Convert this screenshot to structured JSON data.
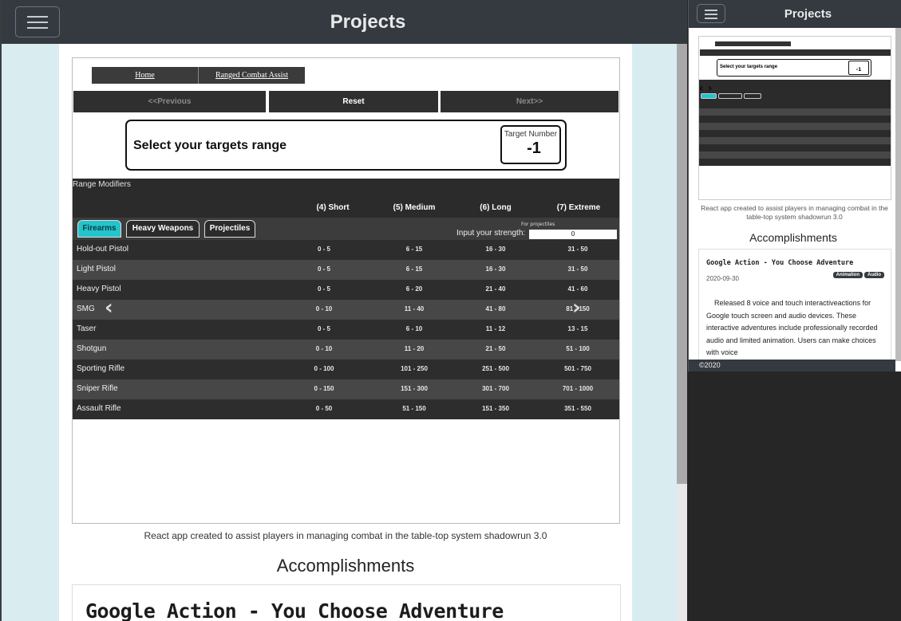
{
  "main": {
    "nav_title": "Projects",
    "project": {
      "breadcrumb": {
        "home": "Home",
        "current": "Ranged Combat Assist"
      },
      "nav": {
        "previous": "<<Previous",
        "reset": "Reset",
        "next": "Next>>"
      },
      "select_heading": "Select your targets range",
      "target_number": {
        "label": "Target Number",
        "value": "-1"
      },
      "table": {
        "caption": "Range Modifiers",
        "columns": [
          "(4) Short",
          "(5) Medium",
          "(6) Long",
          "(7) Extreme"
        ],
        "tabs": [
          "Firearms",
          "Heavy Weapons",
          "Projectiles"
        ],
        "active_tab": "Firearms",
        "for_projectiles": "For projectiles",
        "strength_label": "Input your strength:",
        "strength_value": "0",
        "rows": [
          {
            "name": "Hold-out Pistol",
            "short": "0 - 5",
            "medium": "6 - 15",
            "long": "16 - 30",
            "extreme": "31 - 50"
          },
          {
            "name": "Light Pistol",
            "short": "0 - 5",
            "medium": "6 - 15",
            "long": "16 - 30",
            "extreme": "31 - 50"
          },
          {
            "name": "Heavy Pistol",
            "short": "0 - 5",
            "medium": "6 - 20",
            "long": "21 - 40",
            "extreme": "41 - 60"
          },
          {
            "name": "SMG",
            "short": "0 - 10",
            "medium": "11 - 40",
            "long": "41 - 80",
            "extreme": "81 - 150"
          },
          {
            "name": "Taser",
            "short": "0 - 5",
            "medium": "6 - 10",
            "long": "11 - 12",
            "extreme": "13 - 15"
          },
          {
            "name": "Shotgun",
            "short": "0 - 10",
            "medium": "11 - 20",
            "long": "21 - 50",
            "extreme": "51 - 100"
          },
          {
            "name": "Sporting Rifle",
            "short": "0 - 100",
            "medium": "101 - 250",
            "long": "251 - 500",
            "extreme": "501 - 750"
          },
          {
            "name": "Sniper Rifle",
            "short": "0 - 150",
            "medium": "151 - 300",
            "long": "301 - 700",
            "extreme": "701 - 1000"
          },
          {
            "name": "Assault Rifle",
            "short": "0 - 50",
            "medium": "51 - 150",
            "long": "151 - 350",
            "extreme": "351 - 550"
          }
        ]
      },
      "carousel": {
        "prev_icon": "‹",
        "next_icon": "›"
      }
    },
    "project_caption": "React app created to assist players in managing combat in the table-top system shadowrun 3.0",
    "accomplishments_heading": "Accomplishments",
    "card_title": "Google Action - You Choose Adventure"
  },
  "mobile": {
    "nav_title": "Projects",
    "project_caption": "React app created to assist players in managing combat in the table-top system shadowrun 3.0",
    "accomplishments_heading": "Accomplishments",
    "card": {
      "title": "Google Action - You Choose Adventure",
      "date": "2020-09-30",
      "badges": [
        "Animation",
        "Audio"
      ],
      "body": "Released 8 voice and touch interactiveactions for Google touch screen and audio devices. These interactive adventures include professionally recorded audio and limited animation. Users can make choices with voice"
    },
    "mini_select_heading": "Select your targets range",
    "mini_target_value": "-1",
    "footer": "©2020"
  },
  "colors": {
    "navbar": "#343a40",
    "page_bg": "#d9edf1",
    "active_tab": "#23c4cc"
  }
}
